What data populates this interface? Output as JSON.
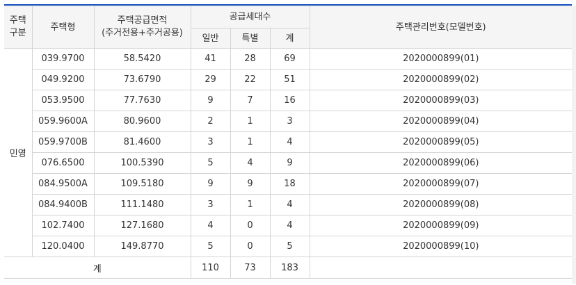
{
  "header": {
    "type_col": [
      "주택",
      "구분"
    ],
    "housing_type": "주택형",
    "area_col": [
      "주택공급면적",
      "(주거전용+주거공용)"
    ],
    "supply_units": "공급세대수",
    "general": "일반",
    "special": "특별",
    "sum": "계",
    "mgmt_no": "주택관리번호(모델번호)"
  },
  "category": "민영",
  "rows": [
    {
      "type": "039.9700",
      "area": "58.5420",
      "general": "41",
      "special": "28",
      "total": "69",
      "mgmt": "2020000899(01)"
    },
    {
      "type": "049.9200",
      "area": "73.6790",
      "general": "29",
      "special": "22",
      "total": "51",
      "mgmt": "2020000899(02)"
    },
    {
      "type": "053.9500",
      "area": "77.7630",
      "general": "9",
      "special": "7",
      "total": "16",
      "mgmt": "2020000899(03)"
    },
    {
      "type": "059.9600A",
      "area": "80.9600",
      "general": "2",
      "special": "1",
      "total": "3",
      "mgmt": "2020000899(04)"
    },
    {
      "type": "059.9700B",
      "area": "81.4600",
      "general": "3",
      "special": "1",
      "total": "4",
      "mgmt": "2020000899(05)"
    },
    {
      "type": "076.6500",
      "area": "100.5390",
      "general": "5",
      "special": "4",
      "total": "9",
      "mgmt": "2020000899(06)"
    },
    {
      "type": "084.9500A",
      "area": "109.5180",
      "general": "9",
      "special": "9",
      "total": "18",
      "mgmt": "2020000899(07)"
    },
    {
      "type": "084.9400B",
      "area": "111.1480",
      "general": "3",
      "special": "1",
      "total": "4",
      "mgmt": "2020000899(08)"
    },
    {
      "type": "102.7400",
      "area": "127.1680",
      "general": "4",
      "special": "0",
      "total": "4",
      "mgmt": "2020000899(09)"
    },
    {
      "type": "120.0400",
      "area": "149.8770",
      "general": "5",
      "special": "0",
      "total": "5",
      "mgmt": "2020000899(10)"
    }
  ],
  "total_row": {
    "label": "계",
    "general": "110",
    "special": "73",
    "total": "183"
  },
  "colors": {
    "accent": "#1a56c4",
    "header_bg": "#f5f5f5",
    "border": "#d4d4d4"
  }
}
